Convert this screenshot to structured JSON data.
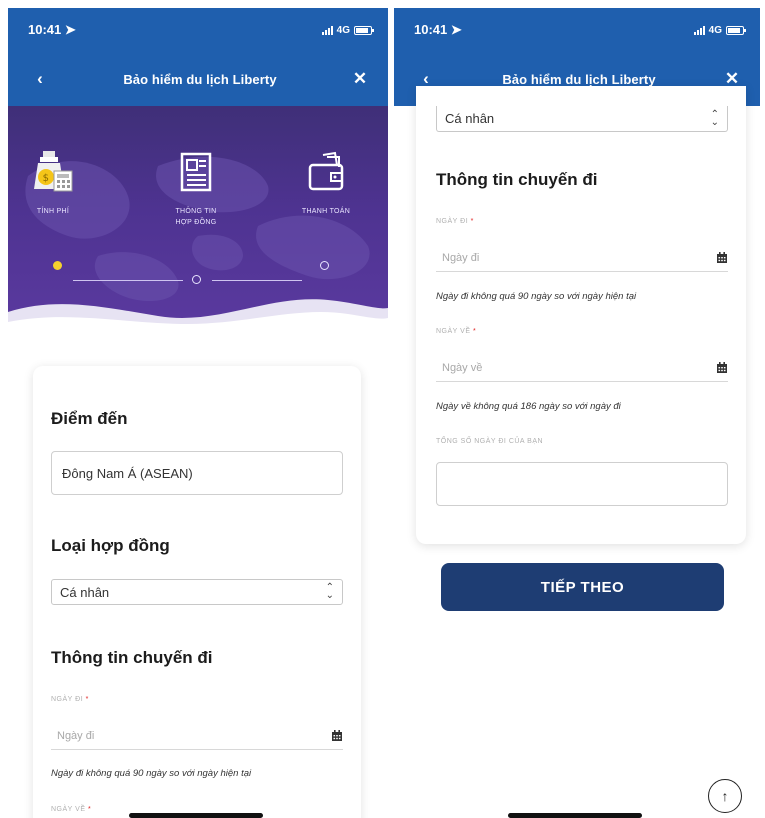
{
  "status": {
    "time": "10:41",
    "network": "4G"
  },
  "nav": {
    "title": "Bảo hiểm du lịch Liberty",
    "back_icon": "chevron-left-icon",
    "close_icon": "close-icon"
  },
  "steps": [
    {
      "label": "TÍNH PHÍ",
      "icon": "money-bag-icon"
    },
    {
      "label": "THÔNG TIN HỢP ĐỒNG",
      "icon": "document-icon"
    },
    {
      "label": "THANH TOÁN",
      "icon": "wallet-icon"
    }
  ],
  "destination": {
    "title": "Điểm đến",
    "value": "Đông Nam Á (ASEAN)"
  },
  "contract": {
    "title": "Loại hợp đồng",
    "selected": "Cá nhân"
  },
  "trip": {
    "title": "Thông tin chuyến đi",
    "depart_label": "NGÀY ĐI",
    "depart_placeholder": "Ngày đi",
    "depart_hint": "Ngày đi không quá 90 ngày so với ngày hiện tại",
    "return_label": "NGÀY VỀ",
    "return_placeholder": "Ngày về",
    "return_hint": "Ngày về không quá 186 ngày so với ngày đi",
    "total_label": "TỔNG SỐ NGÀY ĐI CỦA BẠN",
    "total_value": ""
  },
  "required_mark": "*",
  "next_button": "TIẾP THEO",
  "colors": {
    "header": "#1f5fae",
    "hero": "#4e3391",
    "button": "#1e3d73",
    "active_step": "#f5d22e",
    "required": "#e02020"
  }
}
